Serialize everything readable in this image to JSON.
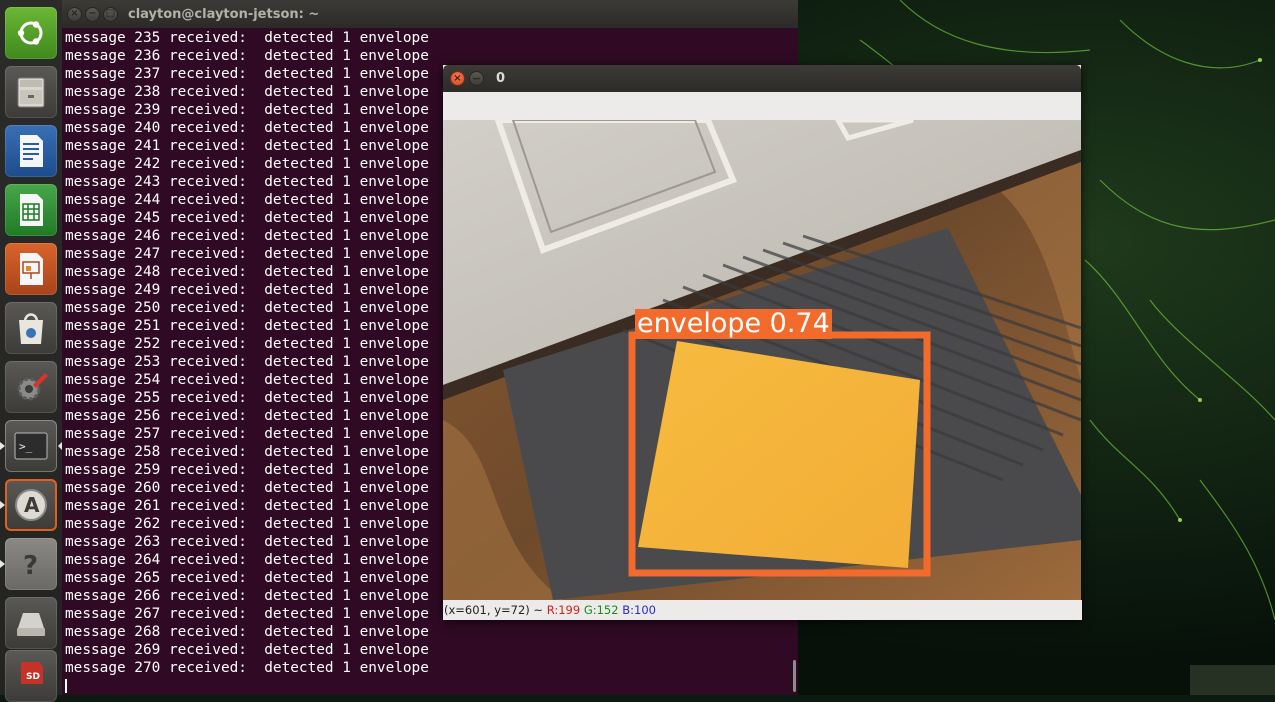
{
  "desktop": {
    "launcher": {
      "items": [
        {
          "name": "dash-home",
          "icon": "ubuntu-logo-icon"
        },
        {
          "name": "files",
          "icon": "file-cabinet-icon"
        },
        {
          "name": "libreoffice-writer",
          "icon": "writer-document-icon"
        },
        {
          "name": "libreoffice-calc",
          "icon": "calc-spreadsheet-icon"
        },
        {
          "name": "libreoffice-impress",
          "icon": "impress-presentation-icon"
        },
        {
          "name": "software-center",
          "icon": "shopping-bag-icon"
        },
        {
          "name": "system-settings",
          "icon": "wrench-gear-icon"
        },
        {
          "name": "terminal",
          "icon": "terminal-icon"
        },
        {
          "name": "software-updater",
          "icon": "updater-icon"
        },
        {
          "name": "help",
          "icon": "question-mark-icon",
          "glyph": "?"
        },
        {
          "name": "removable-drive",
          "icon": "drive-icon"
        },
        {
          "name": "sd-card",
          "icon": "sd-card-icon",
          "glyph": "SD"
        }
      ]
    }
  },
  "terminal": {
    "title": "clayton@clayton-jetson: ~",
    "lines": [
      "message 235 received:  detected 1 envelope",
      "message 236 received:  detected 1 envelope",
      "message 237 received:  detected 1 envelope",
      "message 238 received:  detected 1 envelope",
      "message 239 received:  detected 1 envelope",
      "message 240 received:  detected 1 envelope",
      "message 241 received:  detected 1 envelope",
      "message 242 received:  detected 1 envelope",
      "message 243 received:  detected 1 envelope",
      "message 244 received:  detected 1 envelope",
      "message 245 received:  detected 1 envelope",
      "message 246 received:  detected 1 envelope",
      "message 247 received:  detected 1 envelope",
      "message 248 received:  detected 1 envelope",
      "message 249 received:  detected 1 envelope",
      "message 250 received:  detected 1 envelope",
      "message 251 received:  detected 1 envelope",
      "message 252 received:  detected 1 envelope",
      "message 253 received:  detected 1 envelope",
      "message 254 received:  detected 1 envelope",
      "message 255 received:  detected 1 envelope",
      "message 256 received:  detected 1 envelope",
      "message 257 received:  detected 1 envelope",
      "message 258 received:  detected 1 envelope",
      "message 259 received:  detected 1 envelope",
      "message 260 received:  detected 1 envelope",
      "message 261 received:  detected 1 envelope",
      "message 262 received:  detected 1 envelope",
      "message 263 received:  detected 1 envelope",
      "message 264 received:  detected 1 envelope",
      "message 265 received:  detected 1 envelope",
      "message 266 received:  detected 1 envelope",
      "message 267 received:  detected 1 envelope",
      "message 268 received:  detected 1 envelope",
      "message 269 received:  detected 1 envelope",
      "message 270 received:  detected 1 envelope"
    ]
  },
  "viewer": {
    "title": "0",
    "detection": {
      "label": "envelope 0.74",
      "box_color": "#f26b2c"
    },
    "status": {
      "coords": "(x=601, y=72) ~",
      "r": "R:199",
      "g": "G:152",
      "b": "B:100"
    }
  },
  "colors": {
    "terminal_bg": "#300a24",
    "terminal_text": "#ffffff",
    "detection_orange": "#f26b2c",
    "envelope_yellow": "#f6b63c"
  }
}
